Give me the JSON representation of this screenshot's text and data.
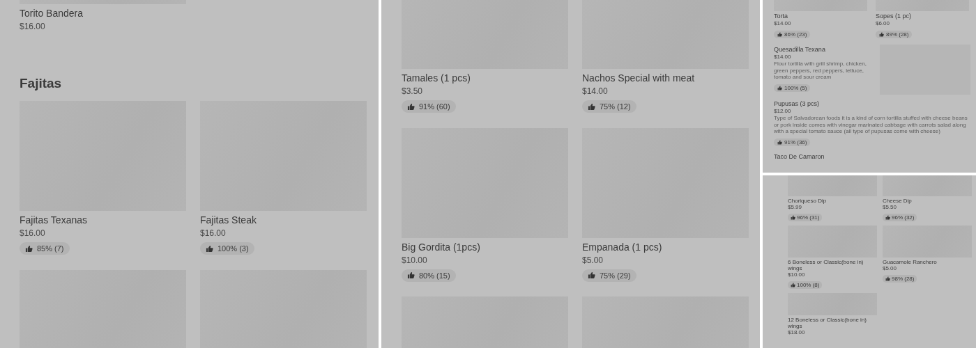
{
  "panels": [
    {
      "kind": "large",
      "blocks": [
        {
          "kind": "row",
          "cards": [
            {
              "name": "Torito Bandera",
              "price": "$16.00"
            }
          ]
        },
        {
          "kind": "heading",
          "text": "Fajitas"
        },
        {
          "kind": "row",
          "cards": [
            {
              "name": "Fajitas Texanas",
              "price": "$16.00",
              "rating": "85% (7)"
            },
            {
              "name": "Fajitas Steak",
              "price": "$16.00",
              "rating": "100% (3)"
            }
          ]
        },
        {
          "kind": "row"
        }
      ]
    },
    {
      "kind": "large",
      "blocks": [
        {
          "kind": "row",
          "cards": [
            {
              "name": "Tamales (1 pcs)",
              "price": "$3.50",
              "rating": "91% (60)"
            },
            {
              "name": "Nachos Special with meat",
              "price": "$14.00",
              "rating": "75% (12)"
            }
          ]
        },
        {
          "kind": "row",
          "cards": [
            {
              "name": "Big Gordita (1pcs)",
              "price": "$10.00",
              "rating": "80% (15)"
            },
            {
              "name": "Empanada (1 pcs)",
              "price": "$5.00",
              "rating": "75% (29)"
            }
          ]
        },
        {
          "kind": "row"
        }
      ]
    },
    {
      "kind": "small",
      "blocks": [
        {
          "kind": "row",
          "cards": [
            {
              "name": "Torta",
              "price": "$14.00",
              "rating": "86% (23)"
            },
            {
              "name": "Sopes (1 pc)",
              "price": "$6.00",
              "rating": "89% (28)"
            }
          ]
        },
        {
          "kind": "list",
          "name": "Quesadilla Texana",
          "price": "$14.00",
          "description": "Flour tortilla with grill shrimp, chicken, green peppers, red peppers, lettuce, tomato and sour cream",
          "rating": "100% (5)",
          "image": true
        },
        {
          "kind": "list",
          "name": "Pupusas (3 pcs)",
          "price": "$12.00",
          "description": "Type of Salvadorean foods it is a kind of corn tortilla stuffed with cheese beans or pork inside comes with vinegar marinated cabbage with carrots salad along with a special tomato sauce (all type of pupusas come with cheese)",
          "rating": "91% (36)",
          "image": false
        },
        {
          "kind": "list",
          "name": "Taco De Camaron",
          "image": false
        }
      ]
    },
    {
      "kind": "tiny",
      "blocks": [
        {
          "kind": "row",
          "cards": [
            {
              "name": "Choriqueso Dip",
              "price": "$5.99",
              "rating": "96% (31)"
            },
            {
              "name": "Cheese Dip",
              "price": "$5.50",
              "rating": "96% (32)"
            }
          ]
        },
        {
          "kind": "row",
          "cards": [
            {
              "name": "6 Boneless or Classic(bone in) wings",
              "price": "$10.00",
              "rating": "100% (8)"
            },
            {
              "name": "Guacamole Ranchero",
              "price": "$5.00",
              "rating": "98% (28)"
            }
          ]
        },
        {
          "kind": "row",
          "cards": [
            {
              "name": "12 Boneless or Classic(bone in) wings",
              "price": "$18.00"
            }
          ]
        }
      ]
    }
  ]
}
